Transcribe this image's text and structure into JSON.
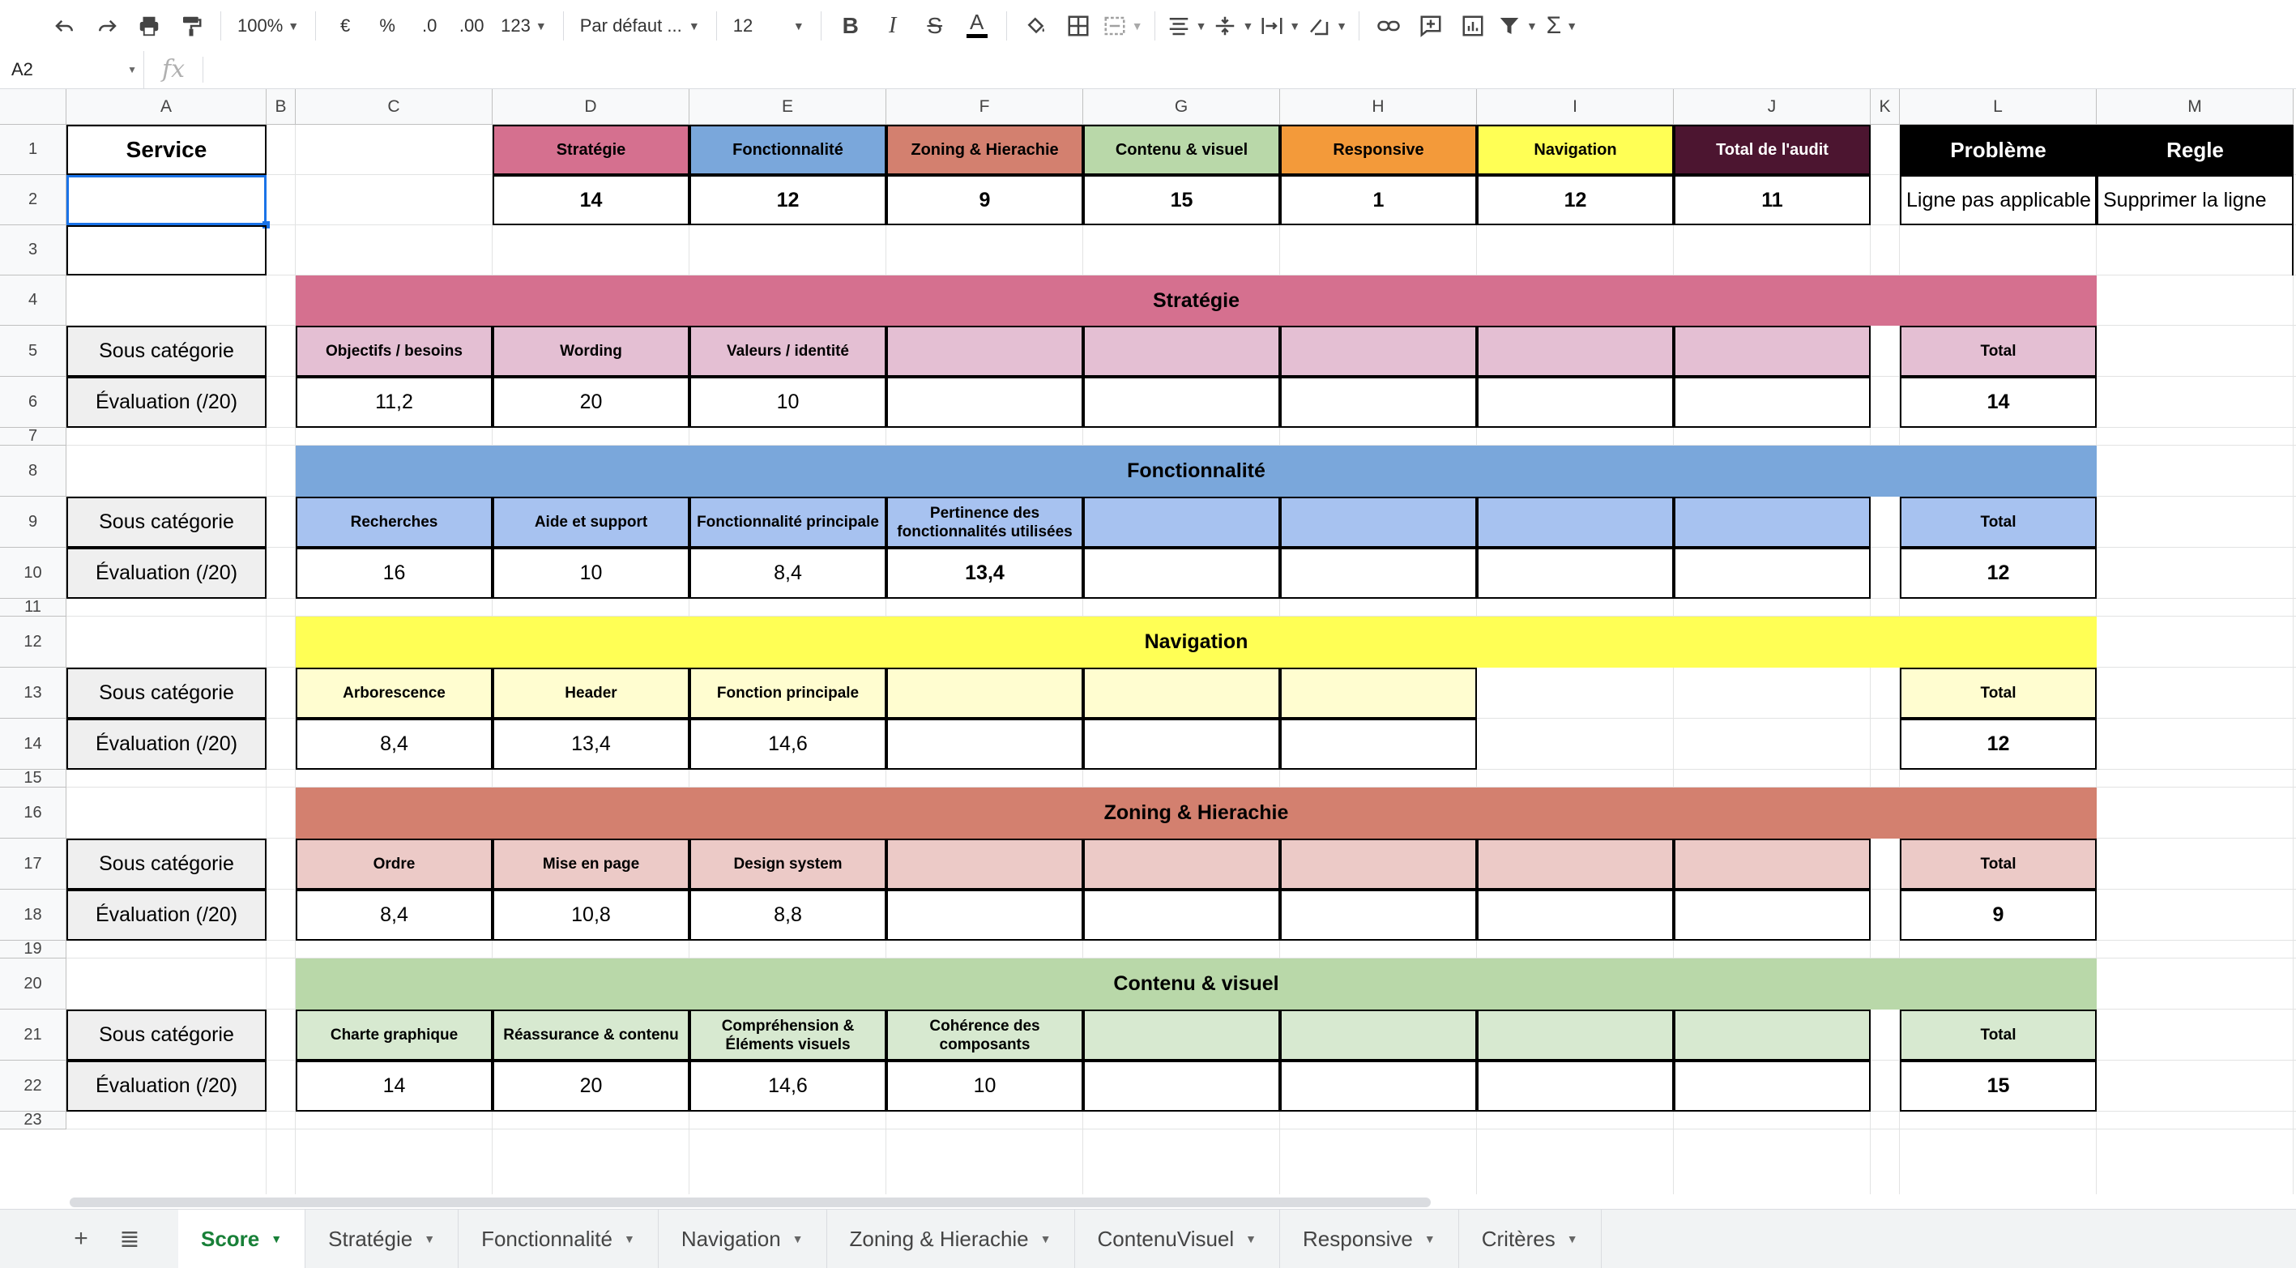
{
  "toolbar": {
    "zoom": "100%",
    "currency": "€",
    "percent": "%",
    "dec_less": ".0",
    "dec_more": ".00",
    "format_more": "123",
    "font": "Par défaut ...",
    "font_size": "12"
  },
  "formula_bar": {
    "cell_ref": "A2",
    "fx": "fx",
    "content": ""
  },
  "columns": [
    "A",
    "B",
    "C",
    "D",
    "E",
    "F",
    "G",
    "H",
    "I",
    "J",
    "K",
    "L",
    "M"
  ],
  "rows": [
    "1",
    "2",
    "3",
    "4",
    "5",
    "6",
    "7",
    "8",
    "9",
    "10",
    "11",
    "12",
    "13",
    "14",
    "15",
    "16",
    "17",
    "18",
    "19",
    "20",
    "21",
    "22",
    "23"
  ],
  "top": {
    "service": "Service",
    "headers": [
      "Stratégie",
      "Fonctionnalité",
      "Zoning & Hierachie",
      "Contenu & visuel",
      "Responsive",
      "Navigation",
      "Total de l'audit"
    ],
    "scores": [
      "14",
      "12",
      "9",
      "15",
      "1",
      "12",
      "11"
    ],
    "probleme_label": "Problème",
    "regle_label": "Regle",
    "probleme_value": "Ligne pas applicable",
    "regle_value": "Supprimer la ligne"
  },
  "labels": {
    "sub": "Sous catégorie",
    "eval": "Évaluation (/20)",
    "total": "Total"
  },
  "sections": [
    {
      "title": "Stratégie",
      "subs": [
        "Objectifs / besoins",
        "Wording",
        "Valeurs / identité",
        "",
        "",
        "",
        "",
        ""
      ],
      "vals": [
        "11,2",
        "20",
        "10",
        "",
        "",
        "",
        "",
        ""
      ],
      "total": "14"
    },
    {
      "title": "Fonctionnalité",
      "subs": [
        "Recherches",
        "Aide et support",
        "Fonctionnalité principale",
        "Pertinence des fonctionnalités utilisées",
        "",
        "",
        "",
        ""
      ],
      "vals": [
        "16",
        "10",
        "8,4",
        "13,4",
        "",
        "",
        "",
        ""
      ],
      "total": "12"
    },
    {
      "title": "Navigation",
      "subs": [
        "Arborescence",
        "Header",
        "Fonction principale",
        "",
        "",
        ""
      ],
      "vals": [
        "8,4",
        "13,4",
        "14,6",
        "",
        "",
        ""
      ],
      "total": "12"
    },
    {
      "title": "Zoning & Hierachie",
      "subs": [
        "Ordre",
        "Mise en page",
        "Design system",
        "",
        "",
        "",
        "",
        ""
      ],
      "vals": [
        "8,4",
        "10,8",
        "8,8",
        "",
        "",
        "",
        "",
        ""
      ],
      "total": "9"
    },
    {
      "title": "Contenu & visuel",
      "subs": [
        "Charte graphique",
        "Réassurance & contenu",
        "Compréhension & Éléments visuels",
        "Cohérence des composants",
        "",
        "",
        "",
        ""
      ],
      "vals": [
        "14",
        "20",
        "14,6",
        "10",
        "",
        "",
        "",
        ""
      ],
      "total": "15"
    }
  ],
  "tabs": [
    "Score",
    "Stratégie",
    "Fonctionnalité",
    "Navigation",
    "Zoning & Hierachie",
    "ContenuVisuel",
    "Responsive",
    "Critères"
  ],
  "active_tab": "Score",
  "colors": {
    "strategie": "#d5708f",
    "strategie_light": "#e4bfd3",
    "fonctionnalite": "#7aa7db",
    "fonctionnalite_light": "#a7c2f0",
    "navigation": "#ffff55",
    "navigation_light": "#fffdd0",
    "zoning": "#d3806f",
    "zoning_light": "#eccac7",
    "contenu": "#b9d8a9",
    "contenu_light": "#d7e9d0",
    "responsive": "#f39a3a",
    "total_audit": "#4c1530",
    "selection": "#1a73e8",
    "active_tab": "#188038"
  }
}
